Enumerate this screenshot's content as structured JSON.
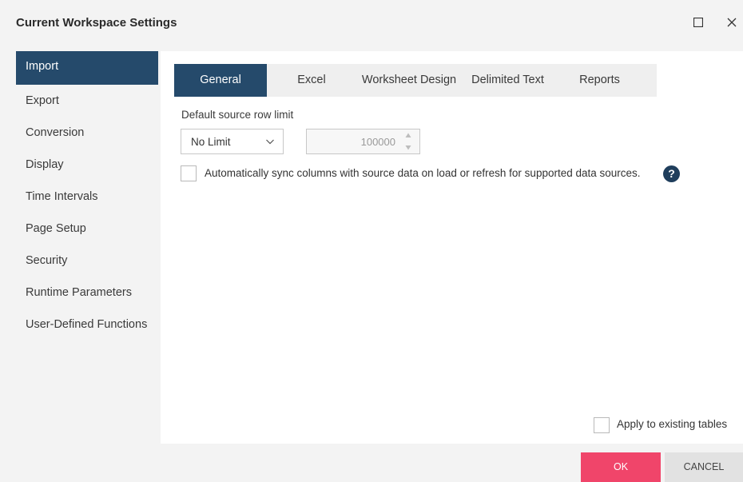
{
  "window": {
    "title": "Current Workspace Settings",
    "maximize_icon": "maximize-icon",
    "close_icon": "close-icon"
  },
  "sidebar": {
    "items": [
      {
        "label": "Import",
        "active": true
      },
      {
        "label": "Export",
        "active": false
      },
      {
        "label": "Conversion",
        "active": false
      },
      {
        "label": "Display",
        "active": false
      },
      {
        "label": "Time Intervals",
        "active": false
      },
      {
        "label": "Page Setup",
        "active": false
      },
      {
        "label": "Security",
        "active": false
      },
      {
        "label": "Runtime Parameters",
        "active": false
      },
      {
        "label": "User-Defined Functions",
        "active": false
      }
    ]
  },
  "tabs": [
    {
      "label": "General",
      "active": true
    },
    {
      "label": "Excel",
      "active": false
    },
    {
      "label": "Worksheet Design",
      "active": false
    },
    {
      "label": "Delimited Text",
      "active": false
    },
    {
      "label": "Reports",
      "active": false
    }
  ],
  "general": {
    "row_limit_label": "Default source row limit",
    "row_limit_select": {
      "selected": "No Limit"
    },
    "row_limit_value": "100000",
    "sync_label": "Automatically sync columns with source data on load or refresh for supported data sources.",
    "sync_checked": false,
    "help_glyph": "?"
  },
  "apply_existing": {
    "label": "Apply to existing tables",
    "checked": false
  },
  "footer": {
    "ok_label": "OK",
    "cancel_label": "CANCEL"
  },
  "colors": {
    "accent_navy": "#254a6b",
    "ok_pink": "#f0456a",
    "background": "#f3f3f3"
  }
}
